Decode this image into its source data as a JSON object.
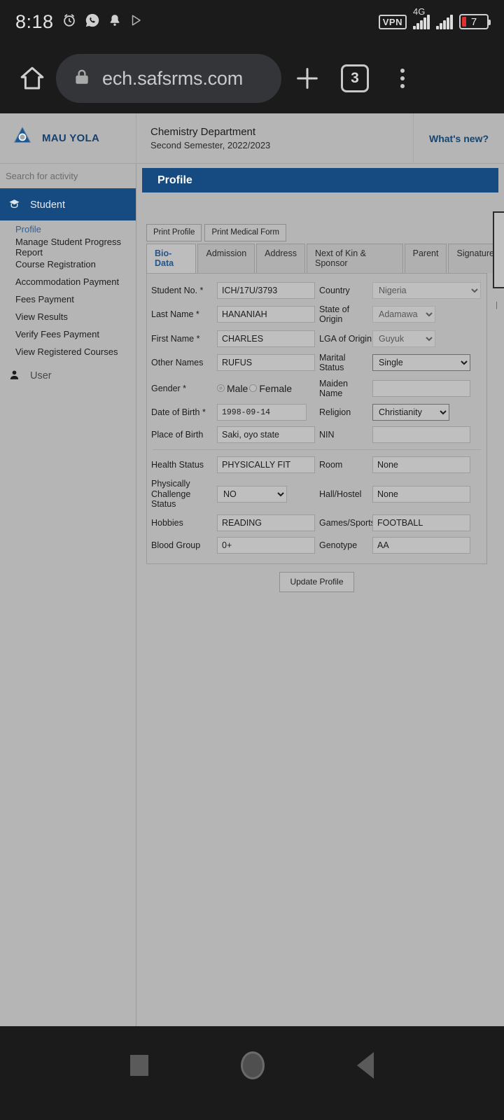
{
  "status_bar": {
    "time": "8:18",
    "icons_left": [
      "alarm-icon",
      "whatsapp-icon",
      "bell-icon",
      "play-icon"
    ],
    "vpn_label": "VPN",
    "network_type": "4G",
    "battery_level": "7"
  },
  "browser": {
    "home_icon": "home-icon",
    "lock_icon": "lock-icon",
    "url": "ech.safsrms.com",
    "new_tab_icon": "plus-icon",
    "tab_count": "3",
    "menu_icon": "kebab-menu-icon"
  },
  "app_header": {
    "logo_icon": "mau-logo-icon",
    "brand": "MAU YOLA",
    "department": "Chemistry Department",
    "session": "Second Semester, 2022/2023",
    "whats_new": "What's new?"
  },
  "sidebar": {
    "search_placeholder": "Search for activity",
    "sections": [
      {
        "label": "Student",
        "icon": "graduation-cap-icon",
        "items": [
          {
            "label": "Profile",
            "active": true
          },
          {
            "label": "Manage Student Progress Report",
            "active": false
          },
          {
            "label": "Course Registration",
            "active": false
          },
          {
            "label": "Accommodation Payment",
            "active": false
          },
          {
            "label": "Fees Payment",
            "active": false
          },
          {
            "label": "View Results",
            "active": false
          },
          {
            "label": "Verify Fees Payment",
            "active": false
          },
          {
            "label": "View Registered Courses",
            "active": false
          }
        ]
      },
      {
        "label": "User",
        "icon": "user-icon",
        "items": []
      }
    ]
  },
  "main": {
    "page_title": "Profile",
    "action_buttons": [
      {
        "label": "Print Profile"
      },
      {
        "label": "Print Medical Form"
      }
    ],
    "tabs": [
      {
        "label": "Bio-Data",
        "active": true
      },
      {
        "label": "Admission",
        "active": false
      },
      {
        "label": "Address",
        "active": false
      },
      {
        "label": "Next of Kin & Sponsor",
        "active": false
      },
      {
        "label": "Parent",
        "active": false
      },
      {
        "label": "Signature",
        "active": false
      }
    ],
    "form": {
      "student_no": {
        "label": "Student No. *",
        "value": "ICH/17U/3793"
      },
      "last_name": {
        "label": "Last Name *",
        "value": "HANANIAH"
      },
      "first_name": {
        "label": "First Name *",
        "value": "CHARLES"
      },
      "other_names": {
        "label": "Other Names",
        "value": "RUFUS"
      },
      "gender": {
        "label": "Gender *",
        "male": "Male",
        "female": "Female",
        "selected": "Male"
      },
      "date_of_birth": {
        "label": "Date of Birth *",
        "value": "1998-09-14"
      },
      "place_of_birth": {
        "label": "Place of Birth",
        "value": "Saki, oyo state"
      },
      "health_status": {
        "label": "Health Status",
        "value": "PHYSICALLY FIT"
      },
      "physically_challenged": {
        "label": "Physically Challenge Status",
        "value": "NO"
      },
      "hobbies": {
        "label": "Hobbies",
        "value": "READING"
      },
      "blood_group": {
        "label": "Blood Group",
        "value": "0+"
      },
      "country": {
        "label": "Country",
        "value": "Nigeria"
      },
      "state_of_origin": {
        "label": "State of Origin",
        "value": "Adamawa"
      },
      "lga_of_origin": {
        "label": "LGA of Origin",
        "value": "Guyuk"
      },
      "marital_status": {
        "label": "Marital Status",
        "value": "Single"
      },
      "maiden_name": {
        "label": "Maiden Name",
        "value": ""
      },
      "religion": {
        "label": "Religion",
        "value": "Christianity"
      },
      "nin": {
        "label": "NIN",
        "value": ""
      },
      "room": {
        "label": "Room",
        "value": "None"
      },
      "hall_hostel": {
        "label": "Hall/Hostel",
        "value": "None"
      },
      "games_sports": {
        "label": "Games/Sports",
        "value": "FOOTBALL"
      },
      "genotype": {
        "label": "Genotype",
        "value": "AA"
      }
    },
    "update_button": "Update Profile"
  },
  "nav_bar": {
    "recents_icon": "square-recents-icon",
    "home_icon": "circle-home-icon",
    "back_icon": "triangle-back-icon"
  },
  "colors": {
    "accent_blue": "#154b80",
    "page_bg": "#b5b5b5",
    "shell_bg": "#1b1b1b",
    "link_blue": "#2f6096"
  }
}
